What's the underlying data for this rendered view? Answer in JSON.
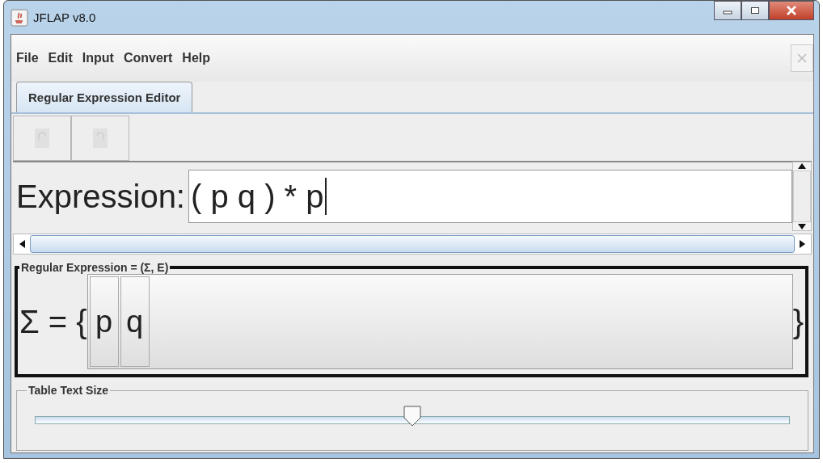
{
  "window": {
    "title": "JFLAP v8.0"
  },
  "menu": [
    "File",
    "Edit",
    "Input",
    "Convert",
    "Help"
  ],
  "tabs": [
    {
      "label": "Regular Expression Editor",
      "selected": true
    }
  ],
  "toolbar": [
    {
      "kind": "undo",
      "disabled": true
    },
    {
      "kind": "redo",
      "disabled": true
    }
  ],
  "expression": {
    "label": "Expression:",
    "value": "( p q ) * p"
  },
  "alphabet": {
    "title": "Regular Expression = (Σ, E)",
    "prefix": "Σ = {",
    "suffix": "}",
    "symbols": [
      "p",
      "q"
    ]
  },
  "table_text_size": {
    "title": "Table Text Size",
    "level": 0.5
  }
}
